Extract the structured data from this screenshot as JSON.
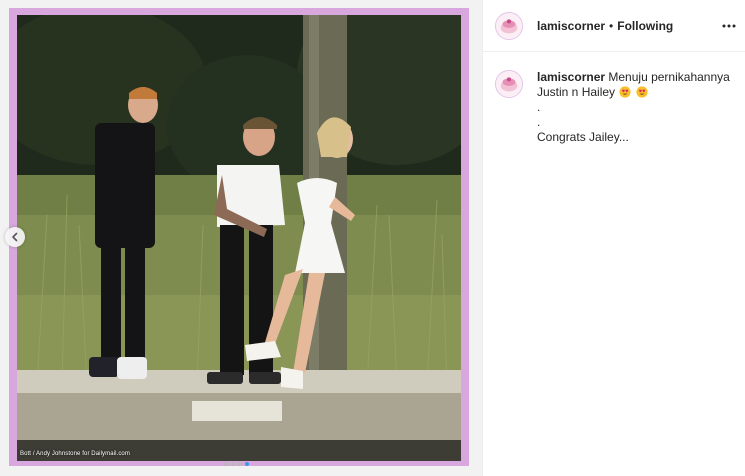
{
  "post": {
    "photo_credit": "Bott / Andy Johnstone for Dailymail.com",
    "carousel_slide_count": 4,
    "carousel_active_index": 3
  },
  "header": {
    "username": "lamiscorner",
    "separator": "•",
    "follow_status": "Following"
  },
  "caption": {
    "username": "lamiscorner",
    "line1": "Menuju pernikahannya",
    "line2": "Justin n Hailey",
    "emojis": [
      "heart-eyes-emoji",
      "heart-eyes-emoji"
    ],
    "line3": ".",
    "line4": ".",
    "line5": "Congrats Jailey..."
  },
  "icons": {
    "prev": "chevron-left-icon",
    "more": "more-options-icon"
  },
  "colors": {
    "frame": "#d7a7dd",
    "dot_active": "#3897f0",
    "dot_inactive": "#b8b8b8"
  }
}
